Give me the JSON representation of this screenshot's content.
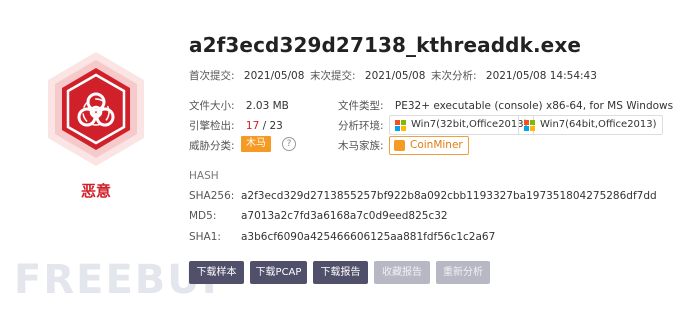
{
  "file": {
    "name": "a2f3ecd329d27138_kthreaddk.exe",
    "verdict": "恶意"
  },
  "dates": {
    "first_submit_label": "首次提交:",
    "first_submit": "2021/05/08",
    "last_submit_label": "末次提交:",
    "last_submit": "2021/05/08",
    "last_analysis_label": "末次分析:",
    "last_analysis": "2021/05/08 14:54:43"
  },
  "info": {
    "size_label": "文件大小:",
    "size": "2.03 MB",
    "type_label": "文件类型:",
    "type": "PE32+ executable (console) x86-64, for MS Windows",
    "engine_label": "引擎检出:",
    "engine_hits": "17",
    "engine_sep": " / ",
    "engine_total": "23",
    "env_label": "分析环境:",
    "env": [
      "Win7(32bit,Office2013)",
      "Win7(64bit,Office2013)"
    ],
    "threat_label": "威胁分类:",
    "threat": "木马",
    "family_label": "木马家族:",
    "family": "CoinMiner"
  },
  "hash": {
    "heading": "HASH",
    "sha256_label": "SHA256:",
    "sha256": "a2f3ecd329d2713855257bf922b8a092cbb1193327ba197351804275286df7dd",
    "md5_label": "MD5:",
    "md5": "a7013a2c7fd3a6168a7c0d9eed825c32",
    "sha1_label": "SHA1:",
    "sha1": "a3b6cf6090a425466606125aa881fdf56c1c2a67"
  },
  "actions": {
    "download_sample": "下载样本",
    "download_pcap": "下载PCAP",
    "download_report": "下载报告",
    "collect_report": "收藏报告",
    "reanalyze": "重新分析"
  },
  "watermark": "FREEBUF",
  "colors": {
    "danger": "#d0212a",
    "button": "#51506b",
    "button_disabled": "#b8b8c4",
    "tag": "#f59a23"
  },
  "icons": {
    "badge": "biohazard-icon",
    "help": "question-circle-icon",
    "env": "windows-flag-icon",
    "family": "coinminer-icon"
  }
}
